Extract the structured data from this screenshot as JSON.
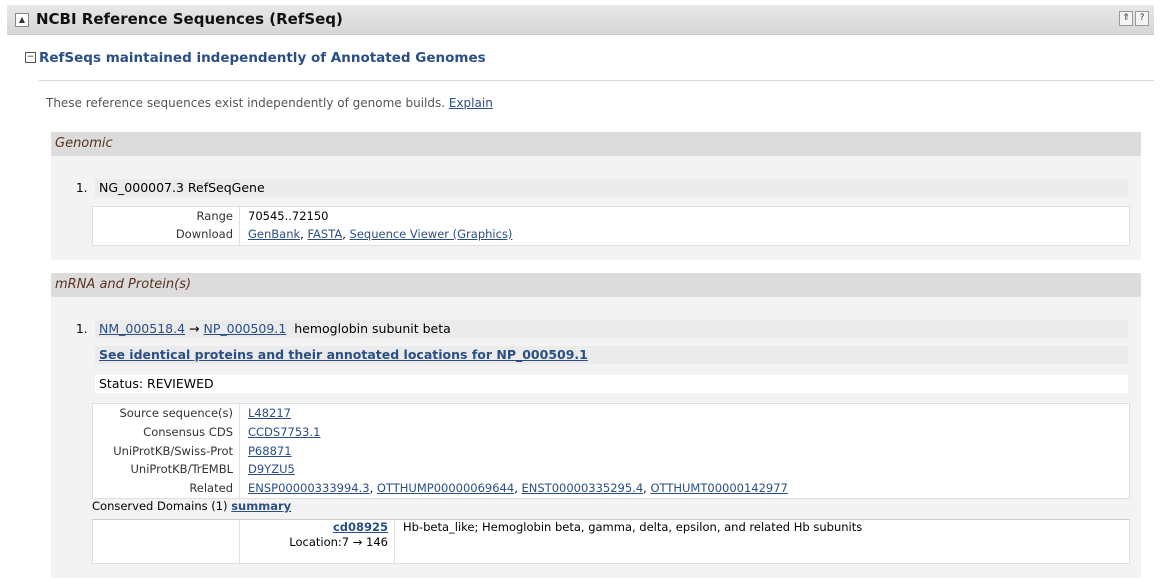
{
  "portlet": {
    "title": "NCBI Reference Sequences (RefSeq)",
    "buttons": [
      "⇑",
      "?"
    ]
  },
  "subsection": {
    "toggle": "−",
    "title": "RefSeqs maintained independently of Annotated Genomes"
  },
  "intro": {
    "text": "These reference sequences exist independently of genome builds.",
    "link": "Explain"
  },
  "genomic": {
    "title": "Genomic",
    "item_num": "1.",
    "item_title": "NG_000007.3 RefSeqGene",
    "range_label": "Range",
    "range_value": "70545..72150",
    "download_label": "Download",
    "downloads": [
      "GenBank",
      "FASTA",
      "Sequence Viewer (Graphics)"
    ]
  },
  "mrna": {
    "title": "mRNA and Protein(s)",
    "item_num": "1.",
    "nm": "NM_000518.4",
    "arrow": "→",
    "np": "NP_000509.1",
    "name": "hemoglobin subunit beta",
    "identical_link": "See identical proteins and their annotated locations for NP_000509.1",
    "status": "Status: REVIEWED",
    "rows": [
      {
        "label": "Source sequence(s)",
        "value": "L48217"
      },
      {
        "label": "Consensus CDS",
        "value": "CCDS7753.1"
      },
      {
        "label": "UniProtKB/Swiss-Prot",
        "value": "P68871"
      },
      {
        "label": "UniProtKB/TrEMBL",
        "value": "D9YZU5"
      }
    ],
    "related_label": "Related",
    "related": [
      "ENSP00000333994.3",
      "OTTHUMP00000069644",
      "ENST00000335295.4",
      "OTTHUMT00000142977"
    ],
    "domains_label": "Conserved Domains (1)",
    "domains_link": "summary",
    "domain_id": "cd08925",
    "domain_location": "Location:7 → 146",
    "domain_desc": "Hb-beta_like; Hemoglobin beta, gamma, delta, epsilon, and related Hb subunits"
  }
}
